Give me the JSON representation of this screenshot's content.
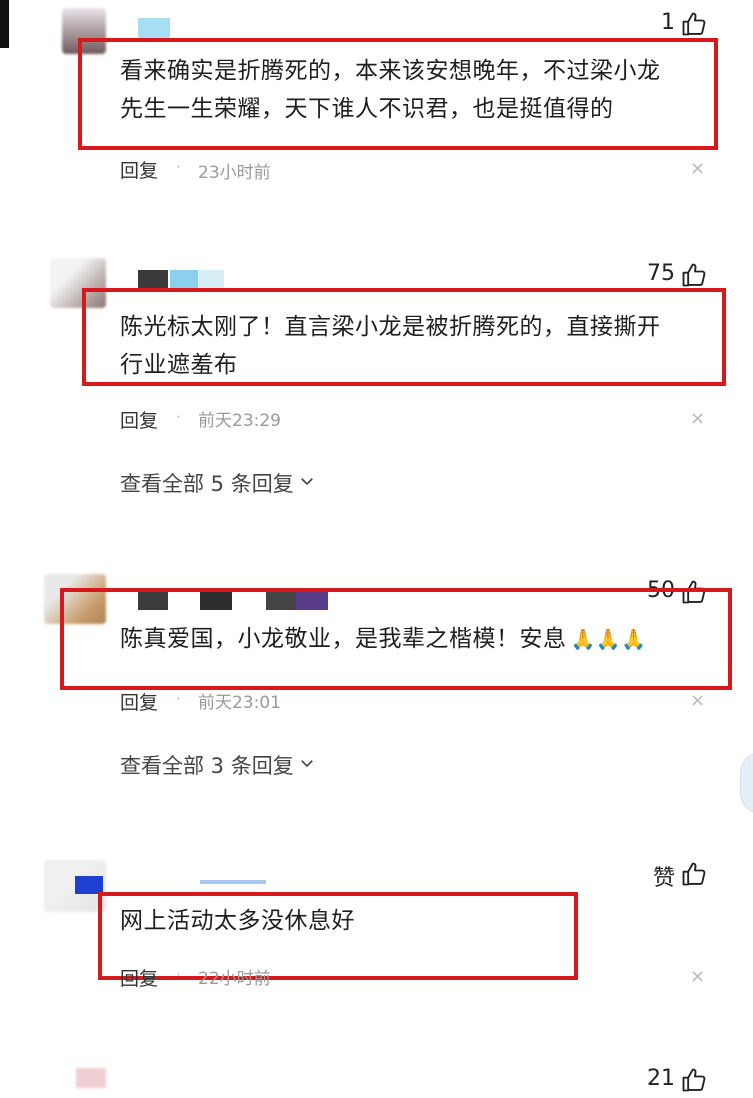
{
  "comments": [
    {
      "likes": "1",
      "text_line1": "看来确实是折腾死的，本来该安想晚年，不过梁小龙",
      "text_line2": "先生一生荣耀，天下谁人不识君，也是挺值得的",
      "reply": "回复",
      "time": "23小时前"
    },
    {
      "likes": "75",
      "text_line1": "陈光标太刚了！直言梁小龙是被折腾死的，直接撕开",
      "text_line2": "行业遮羞布",
      "reply": "回复",
      "time": "前天23:29",
      "view_all": "查看全部 5 条回复"
    },
    {
      "likes": "50",
      "text_line1": "陈真爱国，小龙敬业，是我辈之楷模！安息",
      "emoji": "🙏🙏🙏",
      "reply": "回复",
      "time": "前天23:01",
      "view_all": "查看全部 3 条回复"
    },
    {
      "likes": "赞",
      "text_line1": "网上活动太多没休息好",
      "reply": "回复",
      "time": "22小时前"
    },
    {
      "likes": "21"
    }
  ],
  "dot": "·",
  "close": "×",
  "colors": {
    "highlight": "#d7191c",
    "like_icon": "#222222"
  }
}
